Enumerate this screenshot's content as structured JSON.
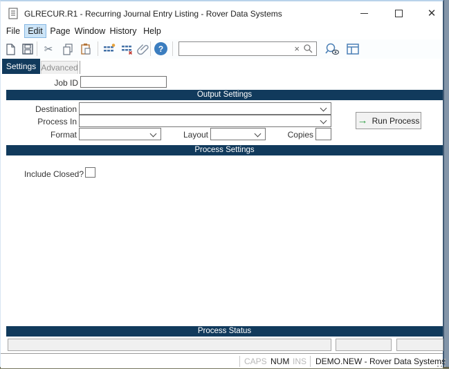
{
  "window": {
    "title": "GLRECUR.R1 - Recurring Journal Entry Listing - Rover Data Systems"
  },
  "menu": {
    "items": [
      {
        "label": "File",
        "active": false
      },
      {
        "label": "Edit",
        "active": true
      },
      {
        "label": "Page",
        "active": false
      },
      {
        "label": "Window",
        "active": false
      },
      {
        "label": "History",
        "active": false
      },
      {
        "label": "Help",
        "active": false
      }
    ]
  },
  "toolbar": {
    "icons": [
      "new-document",
      "save",
      "cut",
      "copy",
      "paste",
      "insert-row",
      "delete-row",
      "attachment",
      "help",
      "preview",
      "window-layout"
    ],
    "search": {
      "value": ""
    }
  },
  "tabs": [
    {
      "label": "Settings",
      "active": true
    },
    {
      "label": "Advanced",
      "active": false
    }
  ],
  "form": {
    "job_id_label": "Job ID",
    "job_id_value": "",
    "output_section": {
      "title": "Output Settings",
      "destination_label": "Destination",
      "destination_value": "",
      "process_in_label": "Process In",
      "process_in_value": "",
      "format_label": "Format",
      "format_value": "",
      "layout_label": "Layout",
      "layout_value": "",
      "copies_label": "Copies",
      "copies_value": "",
      "run_button_label": "Run Process"
    },
    "process_section": {
      "title": "Process Settings",
      "include_closed_label": "Include Closed?",
      "include_closed_checked": false
    },
    "status_section": {
      "title": "Process Status",
      "fields": [
        "",
        "",
        ""
      ]
    }
  },
  "statusbar": {
    "indicators": [
      {
        "label": "CAPS",
        "active": false
      },
      {
        "label": "NUM",
        "active": true
      },
      {
        "label": "INS",
        "active": false
      }
    ],
    "context": "DEMO.NEW - Rover Data Systems"
  },
  "glyphs": {
    "minimize": "–",
    "close": "✕",
    "help": "?",
    "search_clear": "×",
    "run_arrow": "→"
  },
  "colors": {
    "band_navy": "#113a5c",
    "edit_highlight_bg": "#cce4f7",
    "edit_highlight_border": "#86b7e3",
    "help_circle_blue": "#3a7dbf",
    "run_arrow_green": "#2e9e44",
    "desktop_right": "#8395a9",
    "desktop_bottom": "#74745c"
  }
}
